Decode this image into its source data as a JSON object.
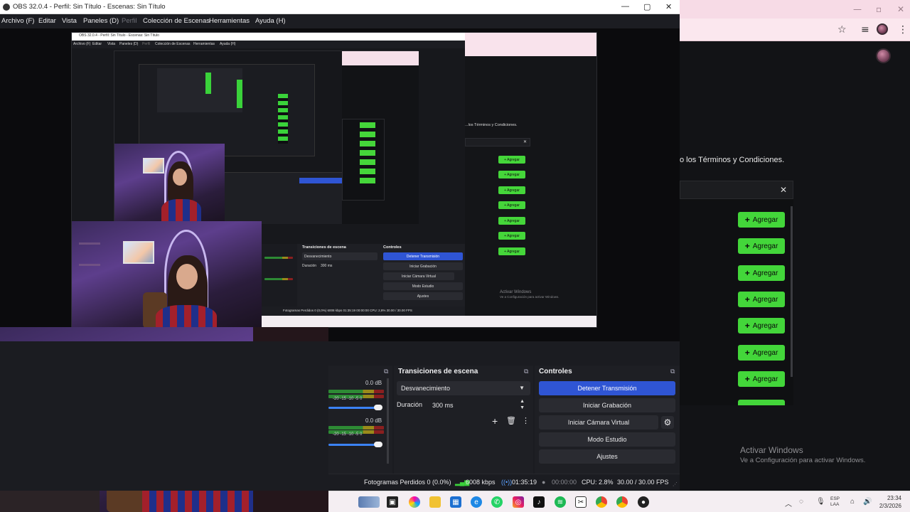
{
  "obs": {
    "title": "OBS 32.0.4 - Perfil: Sin Título - Escenas: Sin Título",
    "menu": [
      "Archivo (F)",
      "Editar",
      "Vista",
      "Paneles (D)",
      "Perfil",
      "Colección de Escenas",
      "Herramientas",
      "Ayuda (H)"
    ]
  },
  "nested": {
    "title": "OBS 32.0.4 - Perfil: Sin Título - Escenas: Sin Título",
    "menu": [
      "Archivo (F)",
      "Editar",
      "Vista",
      "Paneles (D)",
      "Perfil",
      "Colección de Escenas",
      "Herramientas",
      "Ayuda (H)"
    ],
    "terms": "...los Términos y Condiciones.",
    "agregar": "+ Agregar",
    "transiciones": "Transiciones de escena",
    "controles": "Controles",
    "desvanecimiento": "Desvanecimiento",
    "duracion": "Duración",
    "duracion_value": "300 ms",
    "detener": "Detener Transmisión",
    "grabacion": "Iniciar Grabación",
    "camara": "Iniciar Cámara Virtual",
    "estudio": "Modo Estudio",
    "ajustes": "Ajustes",
    "status": "Fotogramas Perdidos 0 (0,0%)   6008 kbps   01:35:19   00:00:00   CPU: 2,8%   30.00 / 30.00 FPS",
    "activar_big": "Activar Windows",
    "activar_small": "Ve a Configuración para activar Windows."
  },
  "browser": {
    "terms": "o los Términos y Condiciones.",
    "agregar_label": "Agregar",
    "agregar_count": 7,
    "activar_big": "Activar Windows",
    "activar_small": "Ve a Configuración para activar Windows."
  },
  "docks": {
    "transitions": {
      "title": "Transiciones de escena",
      "selected": "Desvanecimiento",
      "duration_label": "Duración",
      "duration_value": "300 ms"
    },
    "controls": {
      "title": "Controles",
      "stop_stream": "Detener Transmisión",
      "start_recording": "Iniciar Grabación",
      "start_virtual_cam": "Iniciar Cámara Virtual",
      "studio_mode": "Modo Estudio",
      "settings": "Ajustes"
    },
    "audio": {
      "db1": "0.0 dB",
      "db2": "0.0 dB",
      "scale": "-20  -15  -10  -5   0"
    }
  },
  "status": {
    "dropped": "Fotogramas Perdidos 0 (0.0%)",
    "bitrate": "6008 kbps",
    "stream_time": "01:35:19",
    "rec_time": "00:00:00",
    "cpu": "CPU: 2.8%",
    "fps": "30.00 / 30.00 FPS"
  },
  "taskbar": {
    "lang_line1": "ESP",
    "lang_line2": "LAA",
    "time": "23:34",
    "date": "2/3/2026"
  },
  "colors": {
    "accent_blue": "#2f55d4",
    "agregar_green": "#43d63a"
  }
}
